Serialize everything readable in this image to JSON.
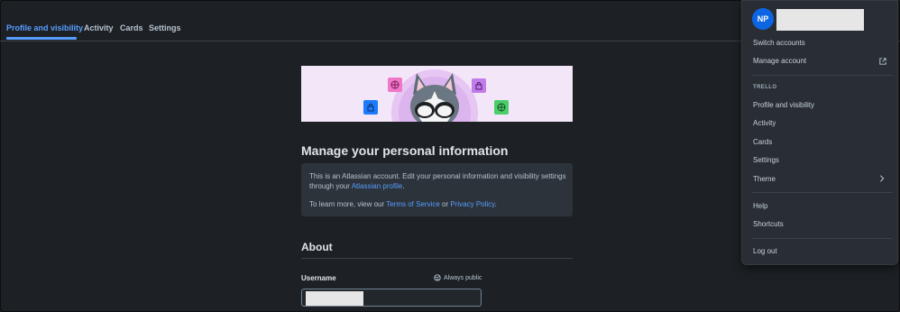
{
  "tabs": [
    {
      "label": "Profile and visibility",
      "active": true
    },
    {
      "label": "Activity",
      "active": false
    },
    {
      "label": "Cards",
      "active": false
    },
    {
      "label": "Settings",
      "active": false
    }
  ],
  "main": {
    "heading": "Manage your personal information",
    "info": {
      "line1_text": "This is an Atlassian account. Edit your personal information and visibility settings through your ",
      "line1_link": "Atlassian profile",
      "line1_end": ".",
      "line2_text": "To learn more, view our ",
      "terms_link": "Terms of Service",
      "or": " or ",
      "privacy_link": "Privacy Policy",
      "line2_end": "."
    },
    "about_heading": "About",
    "username_label": "Username",
    "visibility_label": "Always public"
  },
  "menu": {
    "avatar_initials": "NP",
    "switch_accounts": "Switch accounts",
    "manage_account": "Manage account",
    "section": "TRELLO",
    "items": [
      "Profile and visibility",
      "Activity",
      "Cards",
      "Settings",
      "Theme"
    ],
    "help": "Help",
    "shortcuts": "Shortcuts",
    "logout": "Log out"
  },
  "colors": {
    "background": "#1d2125",
    "accent": "#579dff",
    "avatar": "#0c66e4",
    "banner": "#f3e6f8"
  }
}
